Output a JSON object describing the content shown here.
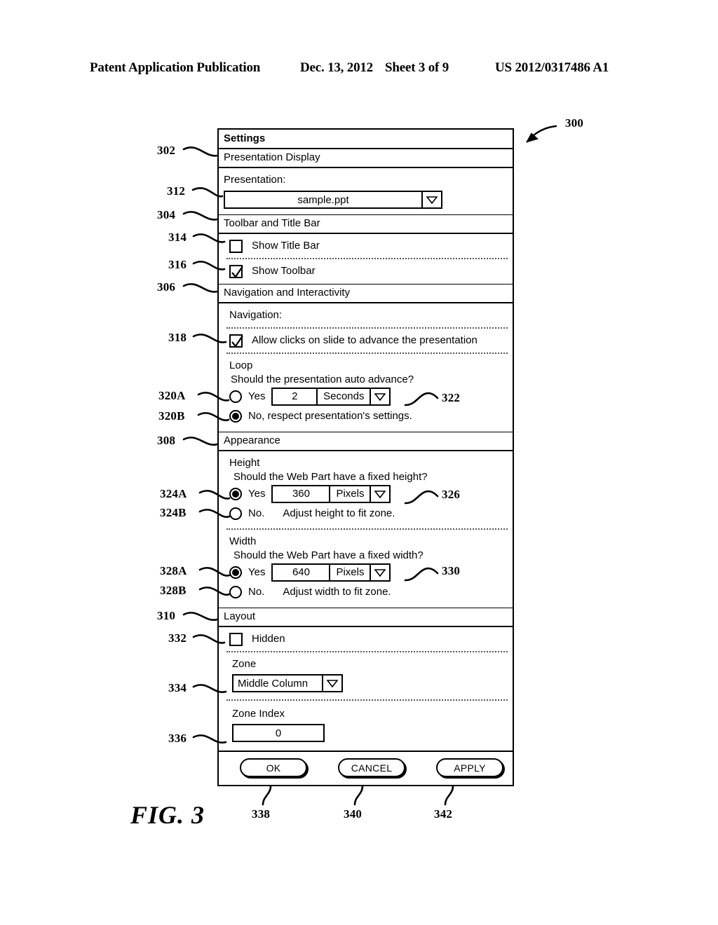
{
  "page_header": {
    "publication": "Patent Application Publication",
    "date": "Dec. 13, 2012",
    "sheet": "Sheet 3 of 9",
    "patent_number": "US 2012/0317486 A1"
  },
  "figure_label": "FIG. 3",
  "dialog": {
    "title": "Settings",
    "sections": {
      "presentation_display": {
        "heading": "Presentation Display",
        "presentation_label": "Presentation:",
        "presentation_value": "sample.ppt"
      },
      "toolbar_title_bar": {
        "heading": "Toolbar and Title Bar",
        "show_title_bar_label": "Show Title Bar",
        "show_title_bar_checked": false,
        "show_toolbar_label": "Show Toolbar",
        "show_toolbar_checked": true
      },
      "navigation_interactivity": {
        "heading": "Navigation and Interactivity",
        "navigation_label": "Navigation:",
        "allow_clicks_label": "Allow clicks on slide to advance the presentation",
        "allow_clicks_checked": true,
        "loop_label": "Loop",
        "loop_question": "Should the presentation auto advance?",
        "loop_yes_label": "Yes",
        "loop_yes_selected": false,
        "loop_interval_value": "2",
        "loop_interval_unit": "Seconds",
        "loop_no_label": "No, respect presentation's settings.",
        "loop_no_selected": true
      },
      "appearance": {
        "heading": "Appearance",
        "height_label": "Height",
        "height_question": "Should the Web Part have a fixed height?",
        "height_yes_label": "Yes",
        "height_yes_selected": true,
        "height_value": "360",
        "height_unit": "Pixels",
        "height_no_label": "No.",
        "height_no_text": "Adjust height to fit zone.",
        "height_no_selected": false,
        "width_label": "Width",
        "width_question": "Should the Web Part have a fixed width?",
        "width_yes_label": "Yes",
        "width_yes_selected": true,
        "width_value": "640",
        "width_unit": "Pixels",
        "width_no_label": "No.",
        "width_no_text": "Adjust width to fit zone.",
        "width_no_selected": false
      },
      "layout": {
        "heading": "Layout",
        "hidden_label": "Hidden",
        "hidden_checked": false,
        "zone_label": "Zone",
        "zone_value": "Middle Column",
        "zone_index_label": "Zone Index",
        "zone_index_value": "0"
      }
    },
    "buttons": {
      "ok": "OK",
      "cancel": "CANCEL",
      "apply": "APPLY"
    }
  },
  "reference_numerals": {
    "n300": "300",
    "n302": "302",
    "n304": "304",
    "n306": "306",
    "n308": "308",
    "n310": "310",
    "n312": "312",
    "n314": "314",
    "n316": "316",
    "n318": "318",
    "n320A": "320A",
    "n320B": "320B",
    "n322": "322",
    "n324A": "324A",
    "n324B": "324B",
    "n326": "326",
    "n328A": "328A",
    "n328B": "328B",
    "n330": "330",
    "n332": "332",
    "n334": "334",
    "n336": "336",
    "n338": "338",
    "n340": "340",
    "n342": "342"
  },
  "colors": {
    "ink": "#000000",
    "paper": "#ffffff"
  }
}
